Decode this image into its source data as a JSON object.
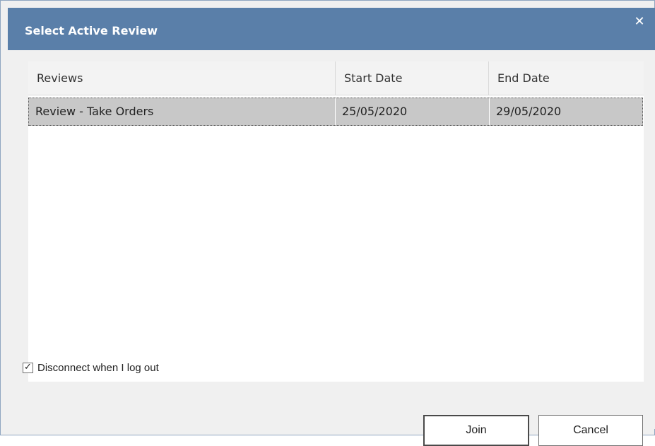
{
  "dialog": {
    "title": "Select Active Review",
    "close_symbol": "✕"
  },
  "table": {
    "columns": [
      "Reviews",
      "Start Date",
      "End Date"
    ],
    "rows": [
      {
        "review": "Review - Take Orders",
        "start": "25/05/2020",
        "end": "29/05/2020",
        "selected": true
      }
    ]
  },
  "options": {
    "disconnect_label": "Disconnect when I log out",
    "disconnect_checked": true
  },
  "buttons": {
    "join": "Join",
    "cancel": "Cancel"
  }
}
